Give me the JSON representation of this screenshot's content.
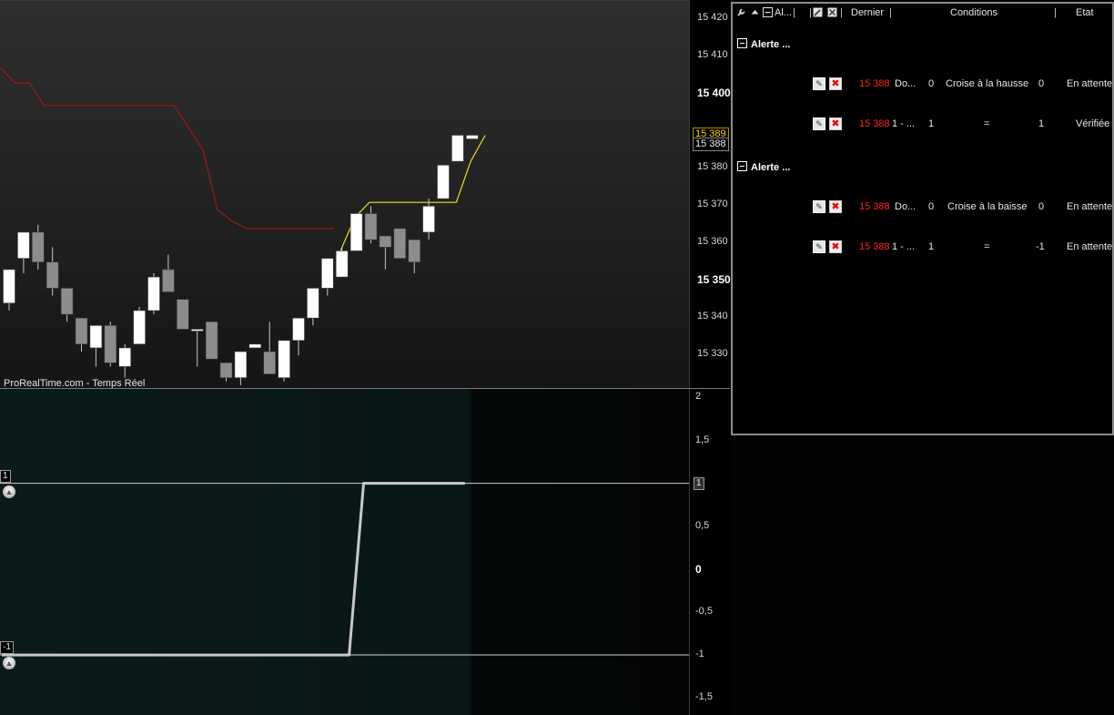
{
  "chart_data": [
    {
      "type": "candlestick",
      "title": "",
      "watermark": "ProRealTime.com - Temps Réel",
      "y_axis": {
        "range": [
          15321,
          15425
        ],
        "ticks": [
          {
            "label": "15 420",
            "value": 15420,
            "bold": false
          },
          {
            "label": "15 410",
            "value": 15410,
            "bold": false
          },
          {
            "label": "15 400",
            "value": 15400,
            "bold": true
          },
          {
            "label": "15 380",
            "value": 15380,
            "bold": false
          },
          {
            "label": "15 370",
            "value": 15370,
            "bold": false
          },
          {
            "label": "15 360",
            "value": 15360,
            "bold": false
          },
          {
            "label": "15 350",
            "value": 15350,
            "bold": true
          },
          {
            "label": "15 340",
            "value": 15340,
            "bold": false
          },
          {
            "label": "15 330",
            "value": 15330,
            "bold": false
          }
        ]
      },
      "price_tags": {
        "last": "15 389",
        "bid": "15 388"
      },
      "colors": {
        "up": "#ffffff",
        "down": "#8c8c8c",
        "wick": "#c8c8c8",
        "resistance": "#a01818",
        "trail": "#f0e020"
      },
      "candles": [
        {
          "o": 15344,
          "h": 15350,
          "l": 15342,
          "c": 15353
        },
        {
          "o": 15356,
          "h": 15363,
          "l": 15352,
          "c": 15363
        },
        {
          "o": 15363,
          "h": 15365,
          "l": 15353,
          "c": 15355
        },
        {
          "o": 15355,
          "h": 15359,
          "l": 15346,
          "c": 15348
        },
        {
          "o": 15348,
          "h": 15348,
          "l": 15339,
          "c": 15341
        },
        {
          "o": 15340,
          "h": 15340,
          "l": 15331,
          "c": 15333
        },
        {
          "o": 15332,
          "h": 15338,
          "l": 15327,
          "c": 15338
        },
        {
          "o": 15338,
          "h": 15339,
          "l": 15327,
          "c": 15328
        },
        {
          "o": 15327,
          "h": 15333,
          "l": 15324,
          "c": 15332
        },
        {
          "o": 15333,
          "h": 15343,
          "l": 15333,
          "c": 15342
        },
        {
          "o": 15342,
          "h": 15352,
          "l": 15341,
          "c": 15351
        },
        {
          "o": 15353,
          "h": 15357,
          "l": 15347,
          "c": 15347
        },
        {
          "o": 15345,
          "h": 15345,
          "l": 15337,
          "c": 15337
        },
        {
          "o": 15337,
          "h": 15337,
          "l": 15327,
          "c": 15337
        },
        {
          "o": 15339,
          "h": 15339,
          "l": 15329,
          "c": 15329
        },
        {
          "o": 15328,
          "h": 15328,
          "l": 15323,
          "c": 15324
        },
        {
          "o": 15324,
          "h": 15331,
          "l": 15322,
          "c": 15331
        },
        {
          "o": 15332,
          "h": 15332,
          "l": 15332,
          "c": 15333
        },
        {
          "o": 15331,
          "h": 15339,
          "l": 15325,
          "c": 15325
        },
        {
          "o": 15324,
          "h": 15334,
          "l": 15323,
          "c": 15334
        },
        {
          "o": 15334,
          "h": 15340,
          "l": 15330,
          "c": 15340
        },
        {
          "o": 15340,
          "h": 15348,
          "l": 15338,
          "c": 15348
        },
        {
          "o": 15348,
          "h": 15356,
          "l": 15346,
          "c": 15356
        },
        {
          "o": 15351,
          "h": 15359,
          "l": 15351,
          "c": 15358
        },
        {
          "o": 15358,
          "h": 15368,
          "l": 15358,
          "c": 15368
        },
        {
          "o": 15368,
          "h": 15370,
          "l": 15360,
          "c": 15361
        },
        {
          "o": 15362,
          "h": 15362,
          "l": 15353,
          "c": 15359
        },
        {
          "o": 15364,
          "h": 15364,
          "l": 15356,
          "c": 15356
        },
        {
          "o": 15361,
          "h": 15361,
          "l": 15352,
          "c": 15355
        },
        {
          "o": 15363,
          "h": 15372,
          "l": 15361,
          "c": 15370
        },
        {
          "o": 15372,
          "h": 15381,
          "l": 15372,
          "c": 15381
        },
        {
          "o": 15382,
          "h": 15389,
          "l": 15382,
          "c": 15389
        },
        {
          "o": 15388,
          "h": 15389,
          "l": 15388,
          "c": 15389
        }
      ],
      "resistance_line": [
        15407,
        15403,
        15403,
        15397,
        15397,
        15397,
        15397,
        15397,
        15397,
        15397,
        15397,
        15397,
        15397,
        15391,
        15385,
        15369,
        15366,
        15364,
        15364,
        15364,
        15364,
        15364,
        15364,
        15364
      ],
      "trailing_line": [
        15358,
        15367,
        15371,
        15371,
        15371,
        15371,
        15371,
        15371,
        15371,
        15382,
        15389
      ]
    },
    {
      "type": "line",
      "title": "",
      "y_axis": {
        "range": [
          -1.7,
          2.1
        ],
        "ticks": [
          {
            "label": "2",
            "value": 2
          },
          {
            "label": "1,5",
            "value": 1.5
          },
          {
            "label": "0,5",
            "value": 0.5
          },
          {
            "label": "0",
            "value": 0
          },
          {
            "label": "-0,5",
            "value": -0.5
          },
          {
            "label": "-1",
            "value": -1
          },
          {
            "label": "-1,5",
            "value": -1.5
          }
        ]
      },
      "levels": [
        {
          "label": "1",
          "value": 1
        },
        {
          "label": "-1",
          "value": -1
        }
      ],
      "axis_tag": "1",
      "series": [
        {
          "values": [
            -1,
            -1,
            -1,
            -1,
            -1,
            -1,
            -1,
            -1,
            -1,
            -1,
            -1,
            -1,
            -1,
            -1,
            -1,
            -1,
            -1,
            -1,
            -1,
            -1,
            -1,
            -1,
            -1,
            -1,
            -1,
            1,
            1,
            1,
            1,
            1,
            1,
            1,
            1
          ]
        }
      ]
    }
  ],
  "alerts_panel": {
    "headers": {
      "col_alert": "Al...",
      "col_last": "Dernier",
      "col_conditions": "Conditions",
      "col_state": "Etat"
    },
    "groups": [
      {
        "title": "Alerte ...",
        "rows": [
          {
            "last": "15 388",
            "indicator": "Do...",
            "left": "0",
            "condition": "Croise à la hausse",
            "right": "0",
            "state": "En attente"
          },
          {
            "last": "15 388",
            "indicator": "1 - ...",
            "left": "1",
            "condition": "=",
            "right": "1",
            "state": "Vérifiée"
          }
        ]
      },
      {
        "title": "Alerte ...",
        "rows": [
          {
            "last": "15 388",
            "indicator": "Do...",
            "left": "0",
            "condition": "Croise à la baisse",
            "right": "0",
            "state": "En attente"
          },
          {
            "last": "15 388",
            "indicator": "1 - ...",
            "left": "1",
            "condition": "=",
            "right": "-1",
            "state": "En attente"
          }
        ]
      }
    ]
  },
  "icons": {
    "tool": "wrench-icon",
    "sort": "sort-asc-icon",
    "collapse": "minus-box-icon",
    "edit": "edit-alert-icon",
    "delete": "delete-alert-icon",
    "bell": "bell-icon"
  }
}
